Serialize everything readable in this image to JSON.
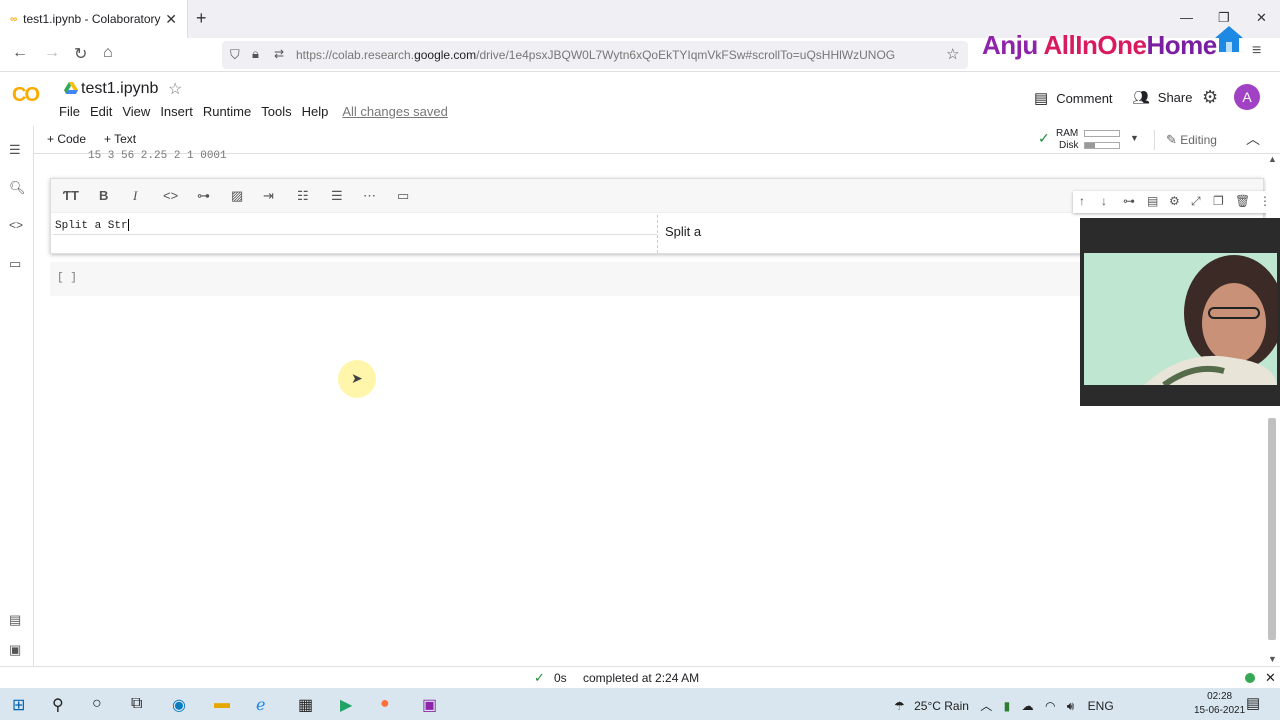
{
  "browser": {
    "tab_title": "test1.ipynb - Colaboratory",
    "new_tab": "+",
    "close": "✕",
    "url_host": "https://colab.research.",
    "url_domain": "google.com",
    "url_path": "/drive/1e4psxJBQW0L7Wytn6xQoEkTYIqmVkFSw#scrollTo=uQsHHlWzUNOG"
  },
  "watermark": {
    "part1": "Anju ",
    "part2": "AllInOne",
    "part3": "Home"
  },
  "colab": {
    "logo": "CO",
    "notebook_title": "test1.ipynb",
    "menu": [
      "File",
      "Edit",
      "View",
      "Insert",
      "Runtime",
      "Tools",
      "Help"
    ],
    "save_status": "All changes saved",
    "comment_label": "Comment",
    "share_label": "Share",
    "avatar_letter": "A"
  },
  "toolbar": {
    "add_code": "+ Code",
    "add_text": "+ Text",
    "ram_label": "RAM",
    "disk_label": "Disk",
    "editing_label": "Editing"
  },
  "notebook": {
    "previous_output": "15 3 56 2.25 2 1 0001",
    "text_cell_source": "Split a Str",
    "text_cell_preview": "Split a",
    "code_cell_run": "[ ]"
  },
  "status": {
    "duration": "0s",
    "message": "completed at 2:24 AM"
  },
  "taskbar": {
    "weather": "25°C  Rain",
    "lang": "ENG",
    "time": "02:28",
    "date": "15-06-2021"
  },
  "colors": {
    "colab_orange": "#f9ab00",
    "avatar": "#a142c4",
    "check": "#1e8e3e"
  }
}
